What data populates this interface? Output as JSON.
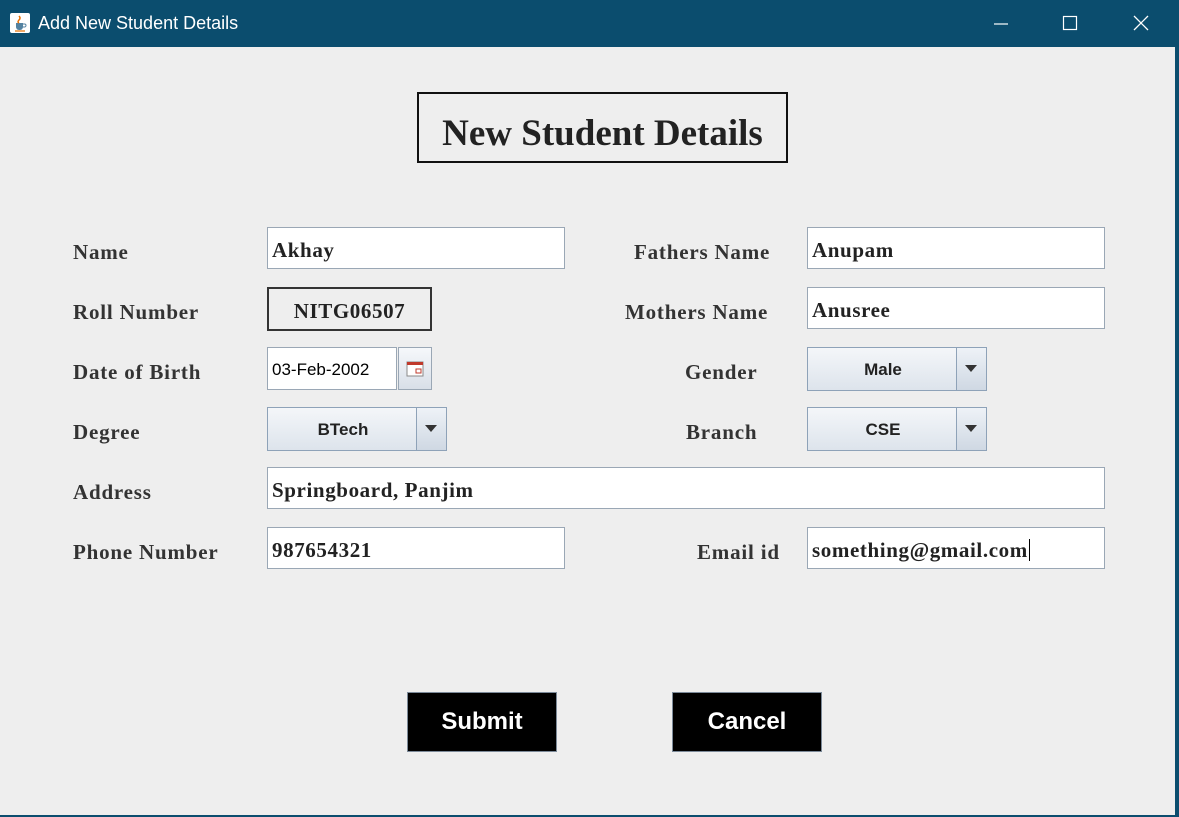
{
  "window": {
    "title": "Add New Student Details",
    "icon": "java-cup-icon",
    "controls": [
      "minimize-icon",
      "maximize-icon",
      "close-icon"
    ]
  },
  "form": {
    "heading": "New Student Details",
    "labels": {
      "name": "Name",
      "roll_number": "Roll Number",
      "dob": "Date of Birth",
      "degree": "Degree",
      "address": "Address",
      "phone": "Phone Number",
      "fathers_name": "Fathers Name",
      "mothers_name": "Mothers Name",
      "gender": "Gender",
      "branch": "Branch",
      "email": "Email id"
    },
    "values": {
      "name": "Akhay",
      "roll_number": "NITG06507",
      "dob": "03-Feb-2002",
      "degree": "BTech",
      "address": "Springboard, Panjim",
      "phone": "987654321",
      "fathers_name": "Anupam",
      "mothers_name": "Anusree",
      "gender": "Male",
      "branch": "CSE",
      "email": "something@gmail.com"
    }
  },
  "buttons": {
    "submit": "Submit",
    "cancel": "Cancel"
  }
}
